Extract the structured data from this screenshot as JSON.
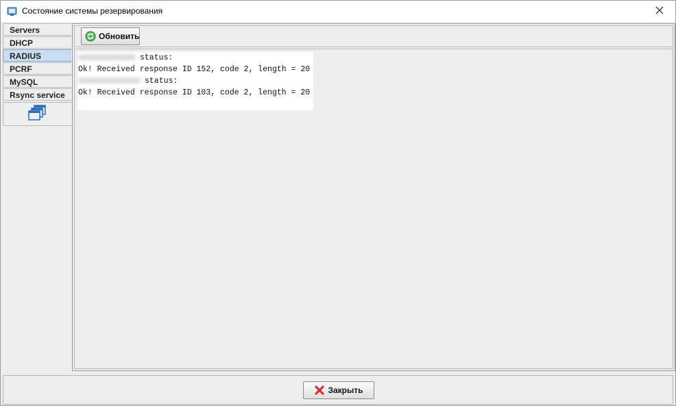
{
  "window": {
    "title": "Состояние системы резервирования",
    "icon": "monitor-app-icon",
    "close_icon": "close-icon"
  },
  "tabs": [
    {
      "label": "Servers",
      "selected": false
    },
    {
      "label": "DHCP",
      "selected": false
    },
    {
      "label": "RADIUS",
      "selected": true
    },
    {
      "label": "PCRF",
      "selected": false
    },
    {
      "label": "MySQL",
      "selected": false
    },
    {
      "label": "Rsync service",
      "selected": false
    }
  ],
  "tab_extra_icon": "windows-stack-icon",
  "toolbar": {
    "refresh_label": "Обновить",
    "refresh_icon": "refresh-icon"
  },
  "status": {
    "lines": [
      {
        "ip_redacted": true,
        "text": "status:"
      },
      {
        "ip_redacted": false,
        "text": "Ok! Received response ID 152, code 2, length = 20"
      },
      {
        "ip_redacted": true,
        "text": "status:"
      },
      {
        "ip_redacted": false,
        "text": "Ok! Received response ID 103, code 2, length = 20"
      }
    ]
  },
  "footer": {
    "close_label": "Закрыть",
    "close_icon": "red-x-icon"
  },
  "colors": {
    "selected_tab": "#c8ddf2",
    "panel_bg": "#eeeeee",
    "text_area_bg": "#ffffff"
  }
}
